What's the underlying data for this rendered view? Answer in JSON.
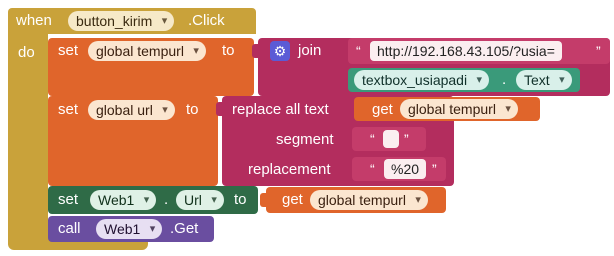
{
  "event": {
    "when": "when",
    "component": "button_kirim",
    "event_name": ".Click",
    "do": "do"
  },
  "row1": {
    "set": "set",
    "var": "global tempurl",
    "to": "to",
    "join": "join",
    "string1": "http://192.168.43.105/?usia=",
    "textbox": "textbox_usiapadi",
    "dot": ".",
    "prop": "Text"
  },
  "row2": {
    "set": "set",
    "var": "global url",
    "to": "to",
    "replace": "replace all text",
    "get": "get",
    "get_var": "global tempurl",
    "segment": "segment",
    "segment_value": "",
    "replacement": "replacement",
    "replacement_value": "%20"
  },
  "row3": {
    "set": "set",
    "component": "Web1",
    "dot": ".",
    "prop": "Url",
    "to": "to",
    "get": "get",
    "get_var": "global tempurl"
  },
  "row4": {
    "call": "call",
    "component": "Web1",
    "method": ".Get"
  },
  "colors": {
    "event": "#c9a23a",
    "variable": "#e0652b",
    "text": "#b32d5e",
    "component": "#2f6b47",
    "method": "#6a4ea0",
    "textbox": "#3a9a7a"
  }
}
